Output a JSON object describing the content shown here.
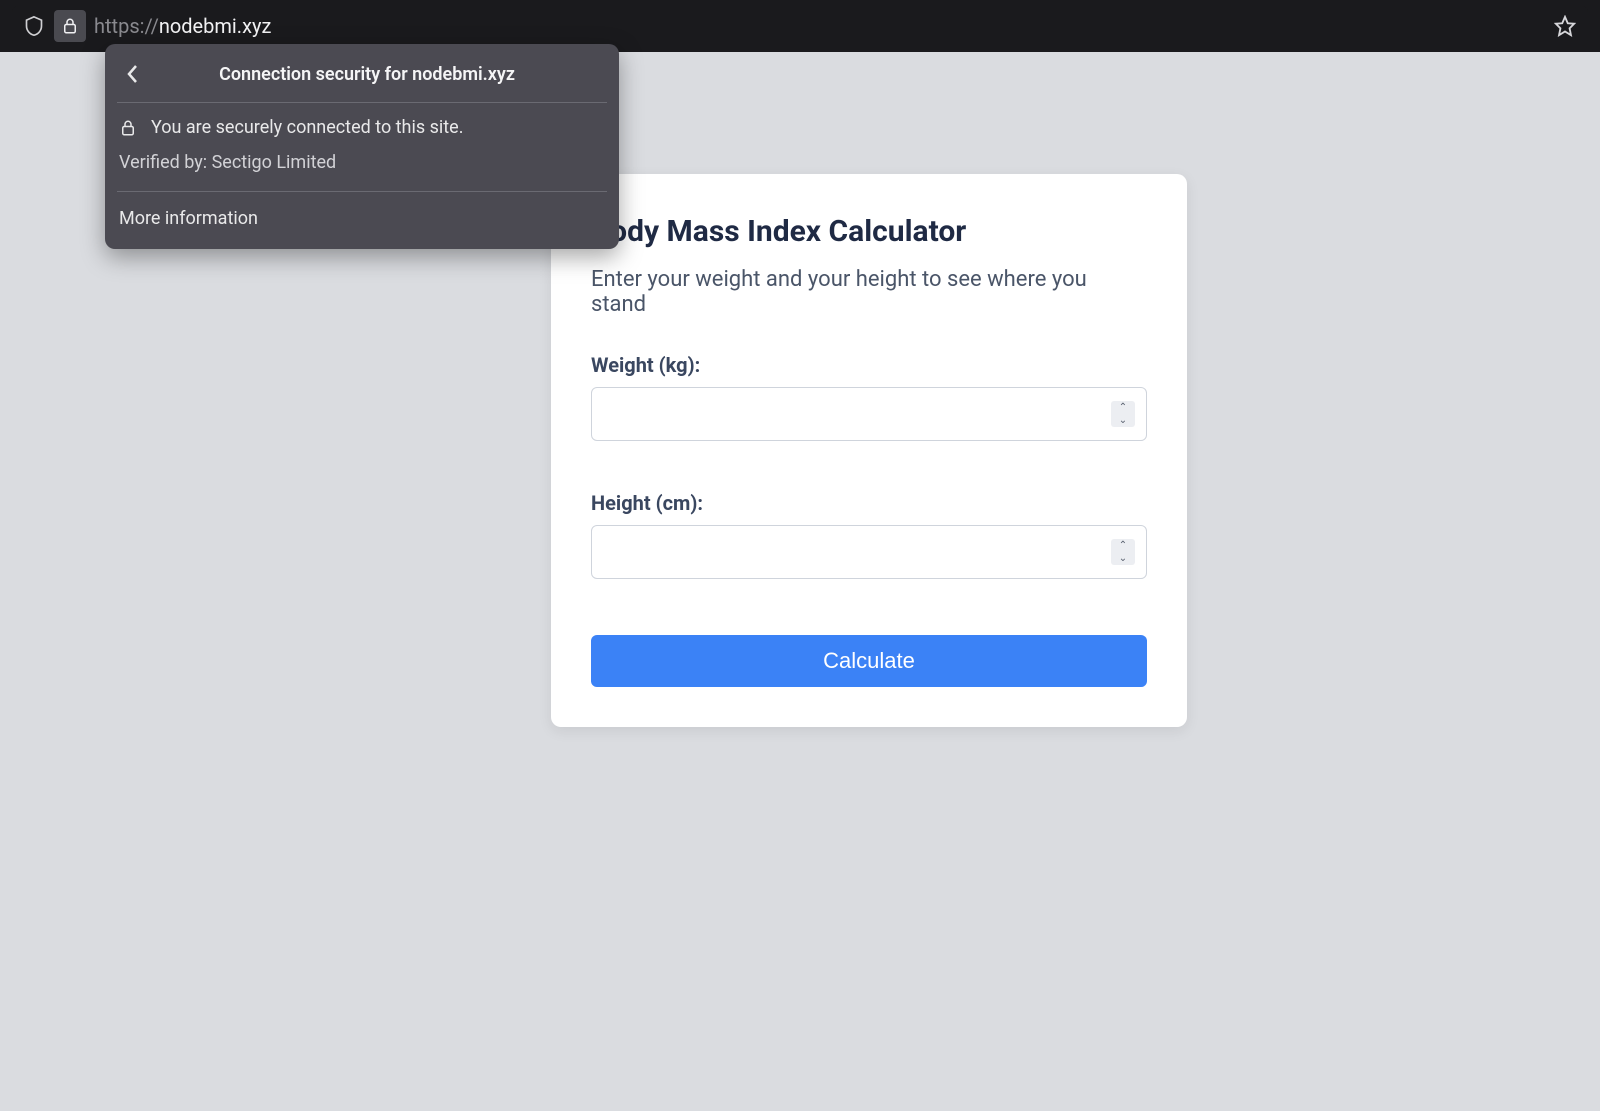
{
  "browser": {
    "url_prefix": "https://",
    "url_domain": "nodebmi.xyz"
  },
  "popover": {
    "title": "Connection security for nodebmi.xyz",
    "secure_text": "You are securely connected to this site.",
    "verified_text": "Verified by: Sectigo Limited",
    "more_info": "More information"
  },
  "card": {
    "title": "Body Mass Index Calculator",
    "subtitle": "Enter your weight and your height to see where you stand",
    "weight_label": "Weight (kg):",
    "height_label": "Height (cm):",
    "weight_value": "",
    "height_value": "",
    "calculate_label": "Calculate"
  }
}
